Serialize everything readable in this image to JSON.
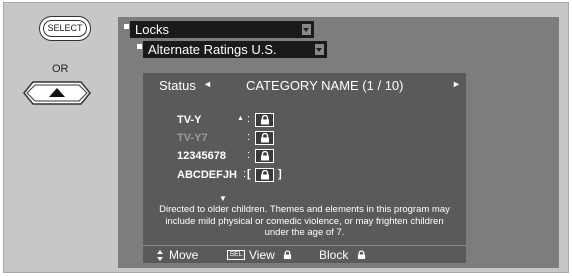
{
  "remote": {
    "select_key_label": "SELECT",
    "or_text": "OR"
  },
  "menu": {
    "locks_title": "Locks",
    "submenu_title": "Alternate Ratings U.S."
  },
  "panel": {
    "status_label": "Status",
    "status_arrow": "◄",
    "category_name": "CATEGORY NAME (1 / 10)",
    "right_arrow": "►"
  },
  "ratings": [
    {
      "label": "TV-Y",
      "locked": true
    },
    {
      "label": "TV-Y7",
      "locked": true,
      "dimmed": true
    },
    {
      "label": "12345678",
      "locked": true
    },
    {
      "label": "ABCDEFJH",
      "locked": true,
      "selected": true
    }
  ],
  "description": "Directed to older children. Themes and elements in this program may include mild physical or comedic violence, or may frighten children under the age of 7.",
  "footer": {
    "move_label": "Move",
    "sel_key": "SEL",
    "view_label": "View",
    "block_label": "Block"
  },
  "colors": {
    "frame_bg": "#c7c7c7",
    "screen_bg": "#7d7d7d",
    "panel_bg": "#5a5a5a",
    "menu_bar_bg": "#1a1a1a"
  }
}
